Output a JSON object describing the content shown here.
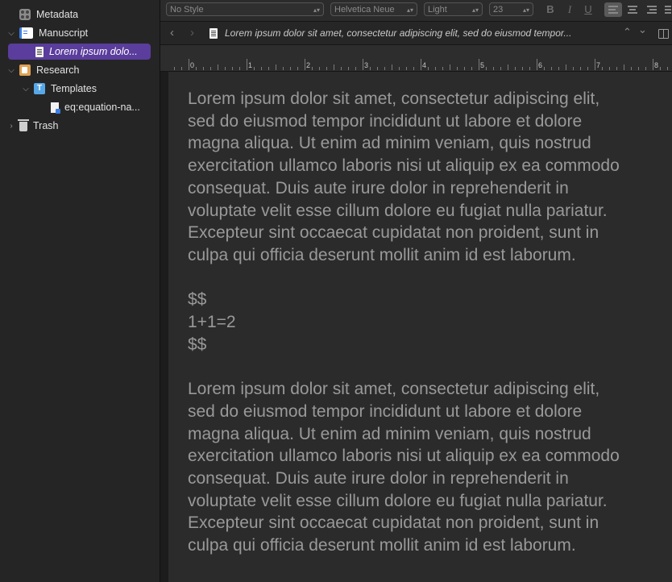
{
  "binder": {
    "items": [
      {
        "label": "Metadata",
        "icon": "metadata-icon"
      },
      {
        "label": "Manuscript",
        "icon": "manuscript-icon",
        "expanded": true
      },
      {
        "label": "Lorem ipsum dolo...",
        "icon": "document-icon",
        "selected": true
      },
      {
        "label": "Research",
        "icon": "research-folder-icon",
        "expanded": true
      },
      {
        "label": "Templates",
        "icon": "templates-folder-icon",
        "expanded": true
      },
      {
        "label": "eq:equation-na...",
        "icon": "template-document-icon"
      },
      {
        "label": "Trash",
        "icon": "trash-icon",
        "expanded": false
      }
    ]
  },
  "format_bar": {
    "style": "No Style",
    "font": "Helvetica Neue",
    "weight": "Light",
    "size": "23",
    "bold": "B",
    "italic": "I",
    "underline": "U"
  },
  "nav_bar": {
    "back": "‹",
    "forward": "›",
    "title": "Lorem ipsum dolor sit amet, consectetur adipiscing elit, sed do eiusmod tempor...",
    "up": "⌃",
    "down": "⌄"
  },
  "ruler": {
    "numbers": [
      "0",
      "1",
      "2",
      "3",
      "4",
      "5",
      "6",
      "7",
      "8"
    ]
  },
  "document": {
    "para1": [
      "Lorem ipsum dolor sit amet, consectetur adipiscing elit,",
      "sed do eiusmod tempor incididunt ut labore et dolore",
      "magna aliqua. Ut enim ad minim veniam, quis nostrud",
      "exercitation ullamco laboris nisi ut aliquip ex ea commodo",
      "consequat. Duis aute irure dolor in reprehenderit in",
      "voluptate velit esse cillum dolore eu fugiat nulla pariatur.",
      "Excepteur sint occaecat cupidatat non proident, sunt in",
      "culpa qui officia deserunt mollit anim id est laborum."
    ],
    "equation": [
      "$$",
      "1+1=2",
      "$$"
    ],
    "para2": [
      "Lorem ipsum dolor sit amet, consectetur adipiscing elit,",
      "sed do eiusmod tempor incididunt ut labore et dolore",
      "magna aliqua. Ut enim ad minim veniam, quis nostrud",
      "exercitation ullamco laboris nisi ut aliquip ex ea commodo",
      "consequat. Duis aute irure dolor in reprehenderit in",
      "voluptate velit esse cillum dolore eu fugiat nulla pariatur.",
      "Excepteur sint occaecat cupidatat non proident, sunt in",
      "culpa qui officia deserunt mollit anim id est laborum."
    ]
  },
  "colors": {
    "selection": "#5a3d9c",
    "text": "#999999",
    "page": "#2b2b2b"
  }
}
